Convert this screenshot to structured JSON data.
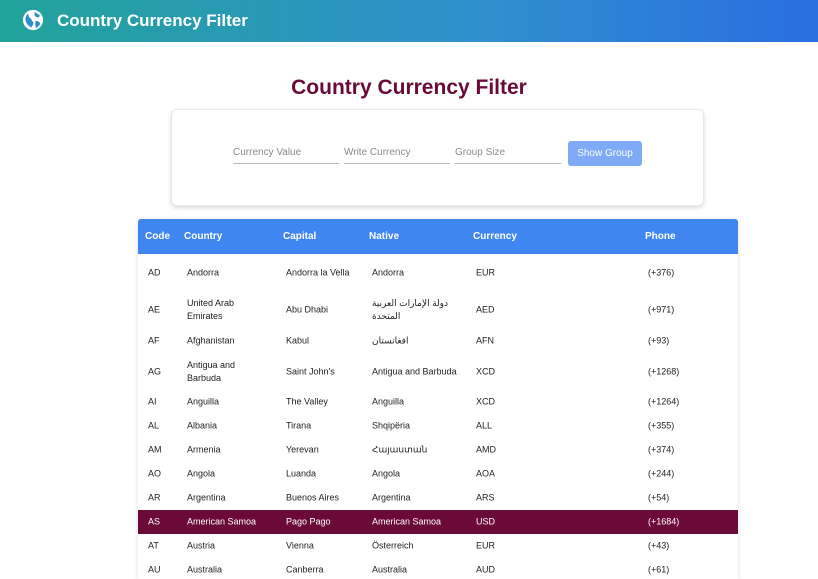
{
  "header": {
    "app_title": "Country Currency Filter",
    "icon": "globe-icon"
  },
  "page_title": "Country Currency Filter",
  "filters": {
    "currency_value_placeholder": "Currency Value",
    "write_currency_placeholder": "Write Currency",
    "group_size_placeholder": "Group Size",
    "show_group_label": "Show Group"
  },
  "colors": {
    "accent": "#3f86f0",
    "brand": "#6b0a39",
    "button": "#7faaf5"
  },
  "table": {
    "columns": [
      "Code",
      "Country",
      "Capital",
      "Native",
      "Currency",
      "Phone"
    ],
    "rows": [
      {
        "code": "AD",
        "country": "Andorra",
        "capital": "Andorra la Vella",
        "native": "Andorra",
        "currency": "EUR",
        "phone": "(+376)"
      },
      {
        "code": "AE",
        "country": "United Arab Emirates",
        "capital": "Abu Dhabi",
        "native": "دولة الإمارات العربية المتحدة",
        "currency": "AED",
        "phone": "(+971)"
      },
      {
        "code": "AF",
        "country": "Afghanistan",
        "capital": "Kabul",
        "native": "افغانستان",
        "currency": "AFN",
        "phone": "(+93)"
      },
      {
        "code": "AG",
        "country": "Antigua and Barbuda",
        "capital": "Saint John's",
        "native": "Antigua and Barbuda",
        "currency": "XCD",
        "phone": "(+1268)"
      },
      {
        "code": "AI",
        "country": "Anguilla",
        "capital": "The Valley",
        "native": "Anguilla",
        "currency": "XCD",
        "phone": "(+1264)"
      },
      {
        "code": "AL",
        "country": "Albania",
        "capital": "Tirana",
        "native": "Shqipëria",
        "currency": "ALL",
        "phone": "(+355)"
      },
      {
        "code": "AM",
        "country": "Armenia",
        "capital": "Yerevan",
        "native": "Հայաստան",
        "currency": "AMD",
        "phone": "(+374)"
      },
      {
        "code": "AO",
        "country": "Angola",
        "capital": "Luanda",
        "native": "Angola",
        "currency": "AOA",
        "phone": "(+244)"
      },
      {
        "code": "AR",
        "country": "Argentina",
        "capital": "Buenos Aires",
        "native": "Argentina",
        "currency": "ARS",
        "phone": "(+54)"
      },
      {
        "code": "AS",
        "country": "American Samoa",
        "capital": "Pago Pago",
        "native": "American Samoa",
        "currency": "USD",
        "phone": "(+1684)",
        "selected": true
      },
      {
        "code": "AT",
        "country": "Austria",
        "capital": "Vienna",
        "native": "Österreich",
        "currency": "EUR",
        "phone": "(+43)"
      },
      {
        "code": "AU",
        "country": "Australia",
        "capital": "Canberra",
        "native": "Australia",
        "currency": "AUD",
        "phone": "(+61)"
      }
    ]
  }
}
